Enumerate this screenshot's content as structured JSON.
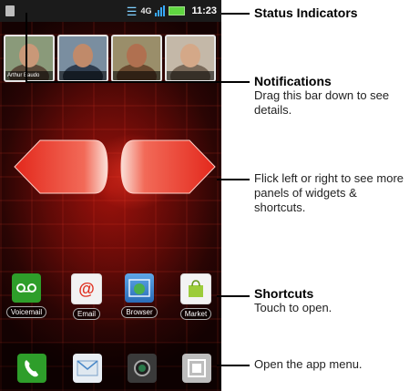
{
  "status_bar": {
    "network": "4G",
    "time": "11:23",
    "icons": [
      "notification-icon",
      "wifi-icon",
      "network-4g-icon",
      "signal-icon",
      "battery-icon"
    ]
  },
  "notifications": {
    "contacts": [
      {
        "name": "Arthur Baudo"
      },
      {
        "name": ""
      },
      {
        "name": ""
      },
      {
        "name": ""
      }
    ]
  },
  "shortcuts": [
    {
      "label": "Voicemail",
      "icon": "voicemail-icon"
    },
    {
      "label": "Email",
      "icon": "email-icon"
    },
    {
      "label": "Browser",
      "icon": "browser-icon"
    },
    {
      "label": "Market",
      "icon": "market-icon"
    }
  ],
  "dock": [
    {
      "icon": "phone-icon"
    },
    {
      "icon": "messaging-icon"
    },
    {
      "icon": "camera-icon"
    },
    {
      "icon": "app-menu-icon"
    }
  ],
  "callouts": {
    "status": {
      "title": "Status Indicators"
    },
    "notifications": {
      "title": "Notifications",
      "body": "Drag this bar down to see details."
    },
    "flick": {
      "body": "Flick left or right to see more panels of widgets & shortcuts."
    },
    "shortcuts": {
      "title": "Shortcuts",
      "body": "Touch to open."
    },
    "app_menu": {
      "body": "Open the app menu."
    }
  },
  "colors": {
    "arrow": "#e3281c",
    "accent": "#c81810",
    "dock_bg": "#000000"
  }
}
